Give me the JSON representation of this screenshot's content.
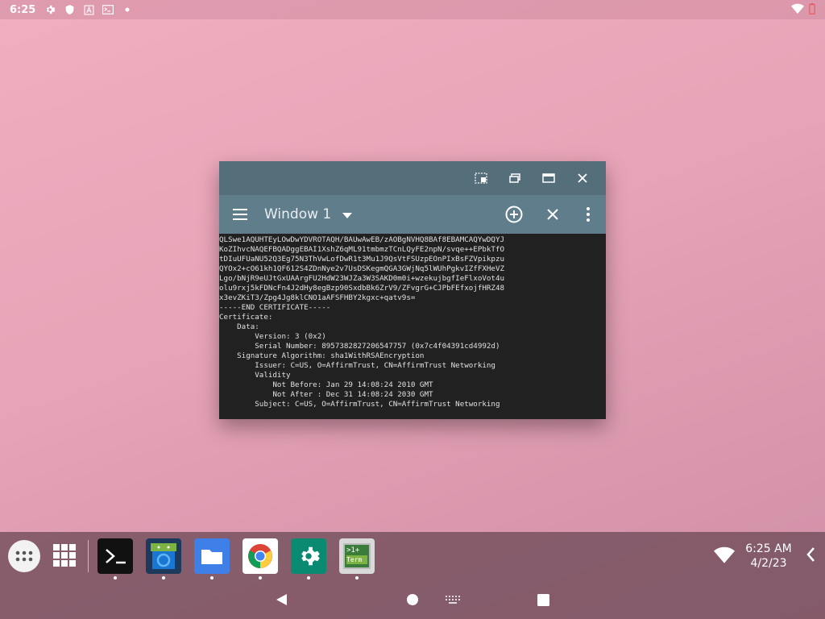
{
  "status_bar": {
    "time": "6:25",
    "left_icons": [
      "settings-icon",
      "shield-icon",
      "a-box-icon",
      "terminal-box-icon",
      "dot-icon"
    ],
    "right_icons": [
      "wifi-icon",
      "battery-icon"
    ]
  },
  "window": {
    "caption_buttons": [
      "restore-icon",
      "maximize-icon",
      "fullscreen-icon",
      "close-icon"
    ],
    "toolbar": {
      "menu_icon": "hamburger-icon",
      "title": "Window 1",
      "dropdown_icon": "caret-down-icon",
      "actions": [
        "add-circle-icon",
        "close-icon",
        "overflow-menu-icon"
      ]
    },
    "terminal_lines": [
      "QLSwe1AQUHTEyLOwDwYDVROTAQH/BAUwAwEB/zAOBgNVHQ8BAf8EBAMCAQYwDQYJ",
      "KoZIhvcNAQEFBQADggEBAI1XshZ6qML91tmbmzTCnLQyFE2npN/svqe++EPbkTfO",
      "tDIuUFUaNU52Q3Eg75N3ThVwLofDwR1t3Mu1J9QsVtFSUzpEOnPIxBsFZVpikpzu",
      "QYOx2+cO61kh1QF612S4ZDnNye2v7UsDSKegmQGA3GWjNq5lWUhPgkvIZfFXHeVZ",
      "Lgo/bNjR9eUJtGxUAArgFU2HdW23WJZa3W3SAKD0m0i+wzekujbgfIeFlxoVot4u",
      "olu9rxj5kFDNcFn4J2dHy8egBzp90SxdbBk6ZrV9/ZFvgrG+CJPbFEfxojfHRZ48",
      "x3evZKiT3/Zpg4Jg8klCNO1aAFSFHBY2kgxc+qatv9s=",
      "-----END CERTIFICATE-----",
      "Certificate:",
      "    Data:",
      "        Version: 3 (0x2)",
      "        Serial Number: 8957382827206547757 (0x7c4f04391cd4992d)",
      "    Signature Algorithm: sha1WithRSAEncryption",
      "        Issuer: C=US, O=AffirmTrust, CN=AffirmTrust Networking",
      "        Validity",
      "            Not Before: Jan 29 14:08:24 2010 GMT",
      "            Not After : Dec 31 14:08:24 2030 GMT",
      "        Subject: C=US, O=AffirmTrust, CN=AffirmTrust Networking"
    ]
  },
  "taskbar": {
    "apps": [
      "Terminal",
      "Android Studio",
      "Files",
      "Chrome",
      "Settings",
      "Term"
    ],
    "term_icon_text": ">1+",
    "term_icon_sub": "Term",
    "clock_time": "6:25 AM",
    "clock_date": "4/2/23"
  },
  "navbar": {
    "buttons": [
      "back-icon",
      "home-icon",
      "keyboard-icon",
      "recents-icon"
    ]
  }
}
